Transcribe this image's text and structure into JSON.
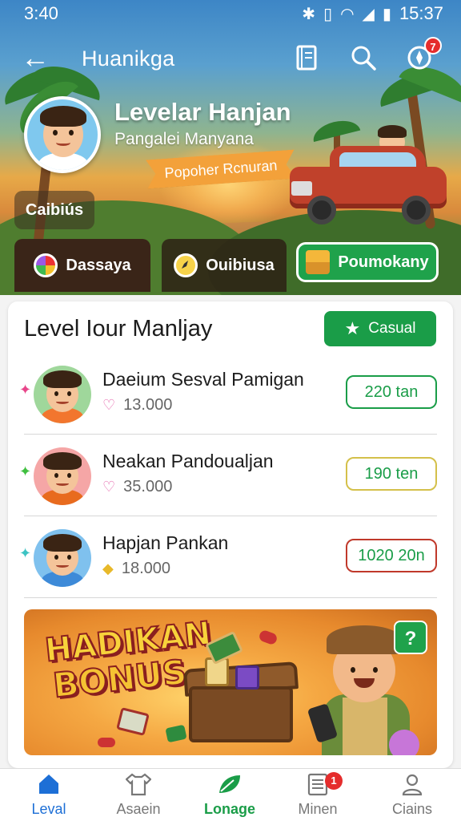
{
  "status": {
    "time": "3:40",
    "clock": "15:37",
    "icons": [
      "bluetooth-icon",
      "vibrate-icon",
      "wifi-icon",
      "signal-icon",
      "battery-icon"
    ]
  },
  "appbar": {
    "title": "Huanikga",
    "notif_count": "7"
  },
  "profile": {
    "name": "Levelar Hanjan",
    "subtitle": "Pangalei Manyana",
    "ribbon": "Popoher Rcnuran",
    "chip": "Caibiús"
  },
  "tabs": [
    {
      "label": "Dassaya"
    },
    {
      "label": "Ouibiusa"
    },
    {
      "label": "Poumokany"
    }
  ],
  "card": {
    "title": "Level Iour Manljay",
    "button": "Casual"
  },
  "rows": [
    {
      "name": "Daeium Sesval Pamigan",
      "meta": "13.000",
      "pill": "220 tan",
      "pill_color": "#1a9d48"
    },
    {
      "name": "Neakan Pandoualjan",
      "meta": "35.000",
      "pill": "190 ten",
      "pill_color": "#d4c04a"
    },
    {
      "name": "Hapjan Pankan",
      "meta": "18.000",
      "pill": "1020 20n",
      "pill_color": "#c0392b"
    }
  ],
  "bonus": {
    "line1": "HADIKAN",
    "line2": "BONUS",
    "help": "?"
  },
  "nav": [
    {
      "label": "Leval"
    },
    {
      "label": "Asaein"
    },
    {
      "label": "Lonage"
    },
    {
      "label": "Minen",
      "badge": "1"
    },
    {
      "label": "Ciains"
    }
  ],
  "colors": {
    "accent_green": "#1a9d48",
    "accent_blue": "#1d6fd6",
    "badge_red": "#e52d2d"
  }
}
